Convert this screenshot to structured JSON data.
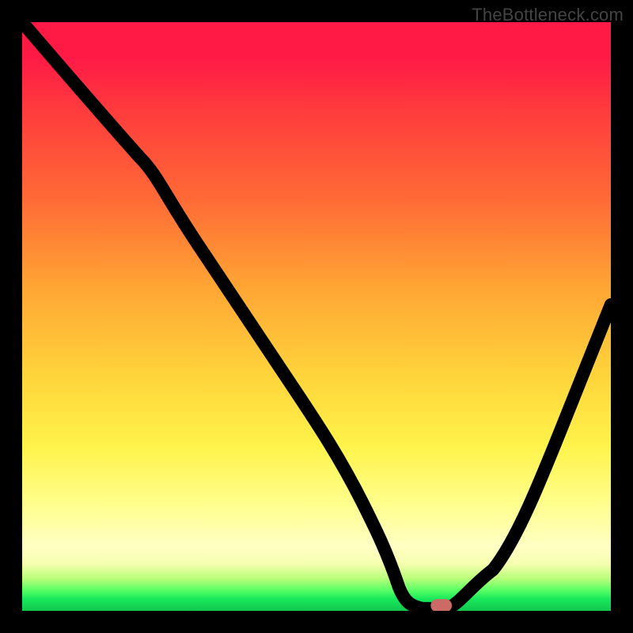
{
  "watermark": "TheBottleneck.com",
  "colors": {
    "frame": "#000000",
    "top": "#ff1a46",
    "mid1": "#ffa534",
    "mid2": "#fff34a",
    "bottom": "#12c74f",
    "curve": "#000000",
    "marker": "#cc6b66"
  },
  "chart_data": {
    "type": "line",
    "title": "",
    "xlabel": "",
    "ylabel": "",
    "xlim": [
      0,
      100
    ],
    "ylim": [
      0,
      100
    ],
    "grid": false,
    "legend": false,
    "note": "Axes are unlabeled in the image; x and y are normalized 0–100 left→right and bottom→top. Values are estimated from the pixels.",
    "series": [
      {
        "name": "bottleneck-curve",
        "x": [
          0,
          6,
          12,
          20,
          24,
          30,
          38,
          46,
          54,
          58,
          62,
          64,
          66,
          70,
          74,
          80,
          86,
          92,
          100
        ],
        "y": [
          100,
          93,
          86,
          77,
          71,
          62,
          50,
          38,
          26,
          18,
          10,
          4,
          1,
          0,
          0,
          7,
          18,
          32,
          52
        ]
      }
    ],
    "marker": {
      "x": 71,
      "y": 0,
      "shape": "rounded-rect",
      "color": "#cc6b66"
    }
  }
}
